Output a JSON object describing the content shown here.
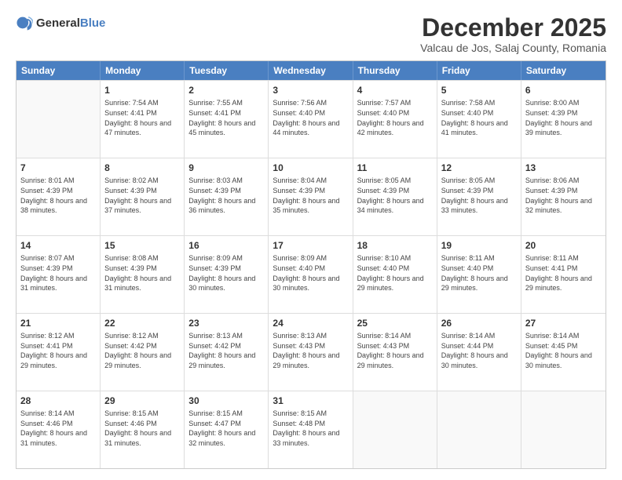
{
  "logo": {
    "general": "General",
    "blue": "Blue"
  },
  "header": {
    "month": "December 2025",
    "location": "Valcau de Jos, Salaj County, Romania"
  },
  "weekdays": [
    "Sunday",
    "Monday",
    "Tuesday",
    "Wednesday",
    "Thursday",
    "Friday",
    "Saturday"
  ],
  "rows": [
    [
      {
        "day": "",
        "sunrise": "",
        "sunset": "",
        "daylight": ""
      },
      {
        "day": "1",
        "sunrise": "Sunrise: 7:54 AM",
        "sunset": "Sunset: 4:41 PM",
        "daylight": "Daylight: 8 hours and 47 minutes."
      },
      {
        "day": "2",
        "sunrise": "Sunrise: 7:55 AM",
        "sunset": "Sunset: 4:41 PM",
        "daylight": "Daylight: 8 hours and 45 minutes."
      },
      {
        "day": "3",
        "sunrise": "Sunrise: 7:56 AM",
        "sunset": "Sunset: 4:40 PM",
        "daylight": "Daylight: 8 hours and 44 minutes."
      },
      {
        "day": "4",
        "sunrise": "Sunrise: 7:57 AM",
        "sunset": "Sunset: 4:40 PM",
        "daylight": "Daylight: 8 hours and 42 minutes."
      },
      {
        "day": "5",
        "sunrise": "Sunrise: 7:58 AM",
        "sunset": "Sunset: 4:40 PM",
        "daylight": "Daylight: 8 hours and 41 minutes."
      },
      {
        "day": "6",
        "sunrise": "Sunrise: 8:00 AM",
        "sunset": "Sunset: 4:39 PM",
        "daylight": "Daylight: 8 hours and 39 minutes."
      }
    ],
    [
      {
        "day": "7",
        "sunrise": "Sunrise: 8:01 AM",
        "sunset": "Sunset: 4:39 PM",
        "daylight": "Daylight: 8 hours and 38 minutes."
      },
      {
        "day": "8",
        "sunrise": "Sunrise: 8:02 AM",
        "sunset": "Sunset: 4:39 PM",
        "daylight": "Daylight: 8 hours and 37 minutes."
      },
      {
        "day": "9",
        "sunrise": "Sunrise: 8:03 AM",
        "sunset": "Sunset: 4:39 PM",
        "daylight": "Daylight: 8 hours and 36 minutes."
      },
      {
        "day": "10",
        "sunrise": "Sunrise: 8:04 AM",
        "sunset": "Sunset: 4:39 PM",
        "daylight": "Daylight: 8 hours and 35 minutes."
      },
      {
        "day": "11",
        "sunrise": "Sunrise: 8:05 AM",
        "sunset": "Sunset: 4:39 PM",
        "daylight": "Daylight: 8 hours and 34 minutes."
      },
      {
        "day": "12",
        "sunrise": "Sunrise: 8:05 AM",
        "sunset": "Sunset: 4:39 PM",
        "daylight": "Daylight: 8 hours and 33 minutes."
      },
      {
        "day": "13",
        "sunrise": "Sunrise: 8:06 AM",
        "sunset": "Sunset: 4:39 PM",
        "daylight": "Daylight: 8 hours and 32 minutes."
      }
    ],
    [
      {
        "day": "14",
        "sunrise": "Sunrise: 8:07 AM",
        "sunset": "Sunset: 4:39 PM",
        "daylight": "Daylight: 8 hours and 31 minutes."
      },
      {
        "day": "15",
        "sunrise": "Sunrise: 8:08 AM",
        "sunset": "Sunset: 4:39 PM",
        "daylight": "Daylight: 8 hours and 31 minutes."
      },
      {
        "day": "16",
        "sunrise": "Sunrise: 8:09 AM",
        "sunset": "Sunset: 4:39 PM",
        "daylight": "Daylight: 8 hours and 30 minutes."
      },
      {
        "day": "17",
        "sunrise": "Sunrise: 8:09 AM",
        "sunset": "Sunset: 4:40 PM",
        "daylight": "Daylight: 8 hours and 30 minutes."
      },
      {
        "day": "18",
        "sunrise": "Sunrise: 8:10 AM",
        "sunset": "Sunset: 4:40 PM",
        "daylight": "Daylight: 8 hours and 29 minutes."
      },
      {
        "day": "19",
        "sunrise": "Sunrise: 8:11 AM",
        "sunset": "Sunset: 4:40 PM",
        "daylight": "Daylight: 8 hours and 29 minutes."
      },
      {
        "day": "20",
        "sunrise": "Sunrise: 8:11 AM",
        "sunset": "Sunset: 4:41 PM",
        "daylight": "Daylight: 8 hours and 29 minutes."
      }
    ],
    [
      {
        "day": "21",
        "sunrise": "Sunrise: 8:12 AM",
        "sunset": "Sunset: 4:41 PM",
        "daylight": "Daylight: 8 hours and 29 minutes."
      },
      {
        "day": "22",
        "sunrise": "Sunrise: 8:12 AM",
        "sunset": "Sunset: 4:42 PM",
        "daylight": "Daylight: 8 hours and 29 minutes."
      },
      {
        "day": "23",
        "sunrise": "Sunrise: 8:13 AM",
        "sunset": "Sunset: 4:42 PM",
        "daylight": "Daylight: 8 hours and 29 minutes."
      },
      {
        "day": "24",
        "sunrise": "Sunrise: 8:13 AM",
        "sunset": "Sunset: 4:43 PM",
        "daylight": "Daylight: 8 hours and 29 minutes."
      },
      {
        "day": "25",
        "sunrise": "Sunrise: 8:14 AM",
        "sunset": "Sunset: 4:43 PM",
        "daylight": "Daylight: 8 hours and 29 minutes."
      },
      {
        "day": "26",
        "sunrise": "Sunrise: 8:14 AM",
        "sunset": "Sunset: 4:44 PM",
        "daylight": "Daylight: 8 hours and 30 minutes."
      },
      {
        "day": "27",
        "sunrise": "Sunrise: 8:14 AM",
        "sunset": "Sunset: 4:45 PM",
        "daylight": "Daylight: 8 hours and 30 minutes."
      }
    ],
    [
      {
        "day": "28",
        "sunrise": "Sunrise: 8:14 AM",
        "sunset": "Sunset: 4:46 PM",
        "daylight": "Daylight: 8 hours and 31 minutes."
      },
      {
        "day": "29",
        "sunrise": "Sunrise: 8:15 AM",
        "sunset": "Sunset: 4:46 PM",
        "daylight": "Daylight: 8 hours and 31 minutes."
      },
      {
        "day": "30",
        "sunrise": "Sunrise: 8:15 AM",
        "sunset": "Sunset: 4:47 PM",
        "daylight": "Daylight: 8 hours and 32 minutes."
      },
      {
        "day": "31",
        "sunrise": "Sunrise: 8:15 AM",
        "sunset": "Sunset: 4:48 PM",
        "daylight": "Daylight: 8 hours and 33 minutes."
      },
      {
        "day": "",
        "sunrise": "",
        "sunset": "",
        "daylight": ""
      },
      {
        "day": "",
        "sunrise": "",
        "sunset": "",
        "daylight": ""
      },
      {
        "day": "",
        "sunrise": "",
        "sunset": "",
        "daylight": ""
      }
    ]
  ]
}
